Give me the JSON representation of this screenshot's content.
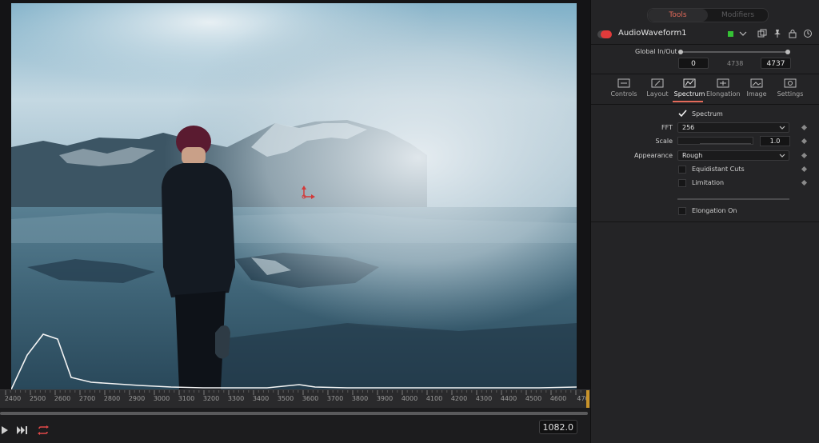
{
  "viewer": {
    "timeline_ticks": [
      "2400",
      "2500",
      "2600",
      "2700",
      "2800",
      "2900",
      "3000",
      "3100",
      "3200",
      "3300",
      "3400",
      "3500",
      "3600",
      "3700",
      "3800",
      "3900",
      "4000",
      "4100",
      "4200",
      "4300",
      "4400",
      "4500",
      "4600",
      "470"
    ],
    "current_frame": "1082.0"
  },
  "panel": {
    "top_tabs": {
      "tools": "Tools",
      "modifiers": "Modifiers"
    },
    "node_name": "AudioWaveform1",
    "global_inout": {
      "label": "Global In/Out",
      "start": "0",
      "duration": "4738",
      "end": "4737"
    },
    "inspector_tabs": [
      "Controls",
      "Layout",
      "Spectrum",
      "Elongation",
      "Image",
      "Settings"
    ],
    "active_tab": "Spectrum",
    "spectrum": {
      "spectrum_label": "Spectrum",
      "spectrum_checked": true,
      "fft_label": "FFT",
      "fft_value": "256",
      "scale_label": "Scale",
      "scale_value": "1.0",
      "appearance_label": "Appearance",
      "appearance_value": "Rough",
      "equidistant_cuts": "Equidistant Cuts",
      "limitation": "Limitation",
      "elongation_on": "Elongation On"
    }
  },
  "colors": {
    "accent": "#e36a5a",
    "node_red": "#e23b3b",
    "node_green": "#35c235",
    "playhead": "#c8932a"
  }
}
